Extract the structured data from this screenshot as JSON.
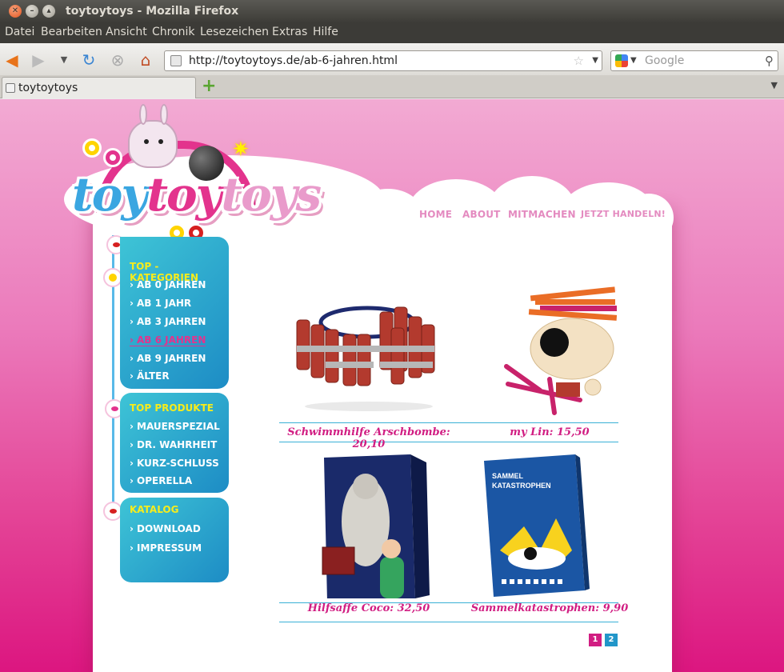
{
  "browser": {
    "window_title": "toytoytoys - Mozilla Firefox",
    "menu": [
      "Datei",
      "Bearbeiten",
      "Ansicht",
      "Chronik",
      "Lesezeichen",
      "Extras",
      "Hilfe"
    ],
    "url": "http://toytoytoys.de/ab-6-jahren.html",
    "search_engine_icon": "google-icon",
    "search_placeholder": "Google",
    "tab_title": "toytoytoys"
  },
  "site": {
    "logo_text": [
      "toy",
      "toy",
      "toys"
    ],
    "top_nav": [
      "HOME",
      "ABOUT",
      "MITMACHEN",
      "JETZT HANDELN!"
    ],
    "categories": {
      "heading": "TOP - KATEGORIEN",
      "items": [
        "AB 0 JAHREN",
        "AB 1 JAHR",
        "AB 3 JAHREN",
        "AB 6 JAHREN",
        "AB 9 JAHREN",
        "ÄLTER"
      ]
    },
    "top_products": {
      "heading": "TOP PRODUKTE",
      "items": [
        "MAUERSPEZIAL",
        "DR. WAHRHEIT",
        "KURZ-SCHLUSS",
        "OPERELLA"
      ]
    },
    "catalog": {
      "heading": "KATALOG",
      "items": [
        "DOWNLOAD",
        "IMPRESSUM"
      ]
    },
    "products": [
      {
        "label": "Schwimmhilfe Arschbombe: 20,10"
      },
      {
        "label": "my Lin: 15,50"
      },
      {
        "label": "Hilfsaffe Coco: 32,50"
      },
      {
        "label": "Sammelkatastrophen: 9,90",
        "box_title": "SAMMEL KATASTROPHEN"
      }
    ],
    "pages": [
      "1",
      "2"
    ],
    "colors": {
      "pink": "#d11d82",
      "blue": "#2296c9",
      "yellow": "#f6ec1c"
    }
  }
}
